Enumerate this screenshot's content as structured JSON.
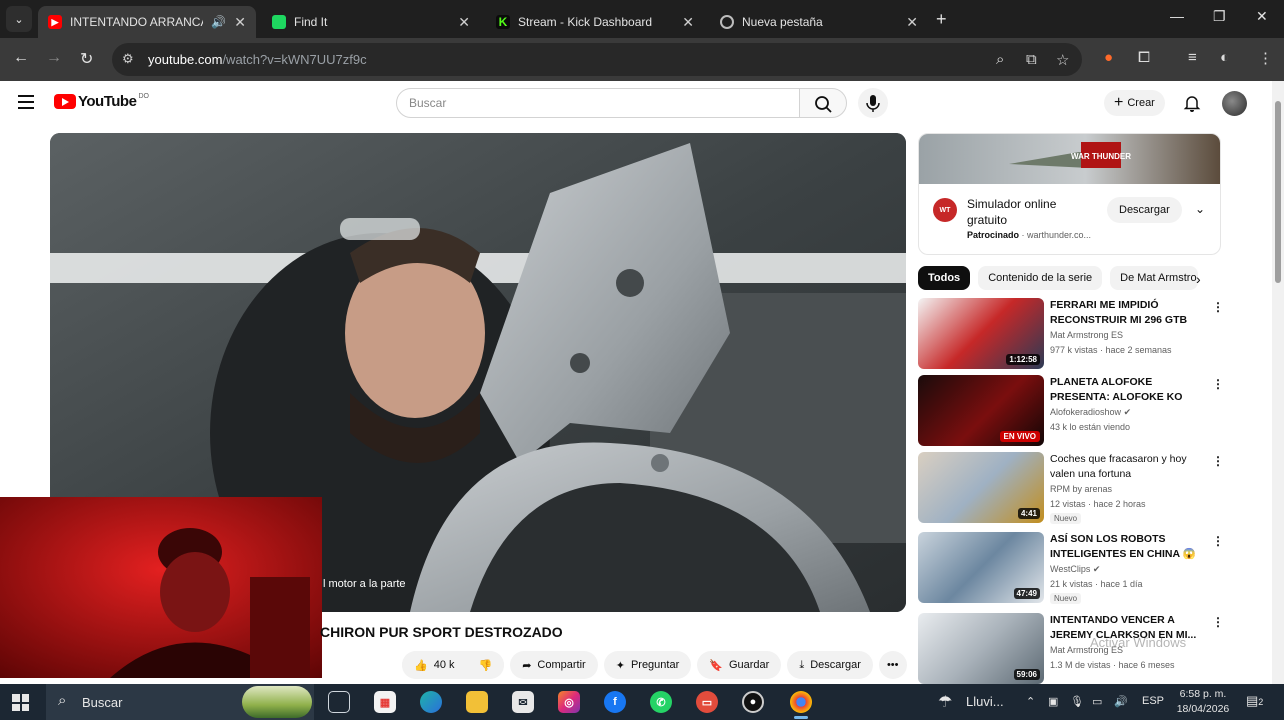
{
  "browser": {
    "tabs": [
      {
        "title": "INTENTANDO ARRANCAR EL",
        "active": true,
        "favicon": "youtube-icon"
      },
      {
        "title": "Find It",
        "active": false,
        "favicon": "find-it-icon"
      },
      {
        "title": "Stream - Kick Dashboard",
        "active": false,
        "favicon": "kick-icon"
      },
      {
        "title": "Nueva pestaña",
        "active": false,
        "favicon": "chrome-icon"
      }
    ],
    "url_host": "youtube.com",
    "url_path": "/watch?v=kWN7UU7zf9c"
  },
  "youtube": {
    "logo_text": "YouTube",
    "country_code": "DO",
    "search_placeholder": "Buscar",
    "create_label": "Crear",
    "video": {
      "subtitle": "l motor a la parte",
      "title": "CHIRON PUR SPORT DESTROZADO",
      "likes": "40 k",
      "actions": [
        "Compartir",
        "Preguntar",
        "Guardar",
        "Descargar"
      ]
    },
    "ad": {
      "title": "Simulador online gratuito",
      "sponsored": "Patrocinado",
      "domain": "warthunder.co...",
      "button": "Descargar",
      "banner_text": "WAR THUNDER"
    },
    "chips": [
      "Todos",
      "Contenido de la serie",
      "De Mat Armstro"
    ],
    "recommendations": [
      {
        "title": "FERRARI ME IMPIDIÓ RECONSTRUIR MI 296 GTB ...",
        "channel": "Mat Armstrong ES",
        "stats": "977 k vistas · hace 2 semanas",
        "duration": "1:12:58",
        "badge": ""
      },
      {
        "title": "PLANETA ALOFOKE PRESENTA: ALOFOKE KO (ESTE DOMINGO...",
        "channel": "Alofokeradioshow",
        "stats": "43 k lo están viendo",
        "duration": "EN VIVO",
        "badge": ""
      },
      {
        "title": "Coches que fracasaron y hoy valen una fortuna",
        "channel": "RPM by arenas",
        "stats": "12 vistas · hace 2 horas",
        "duration": "4:41",
        "badge": "Nuevo"
      },
      {
        "title": "ASÍ SON LOS ROBOTS INTELIGENTES EN CHINA 😱 |...",
        "channel": "WestClips",
        "stats": "21 k vistas · hace 1 día",
        "duration": "47:49",
        "badge": "Nuevo"
      },
      {
        "title": "INTENTANDO VENCER A JEREMY CLARKSON EN MI...",
        "channel": "Mat Armstrong ES",
        "stats": "1.3 M de vistas · hace 6 meses",
        "duration": "59:06",
        "badge": ""
      }
    ],
    "watermark": "Activar Windows"
  },
  "taskbar": {
    "search_label": "Buscar",
    "weather": "Lluvi...",
    "lang": "ESP",
    "time": "6:58 p. m.",
    "date": "18/04/2026",
    "notifications": "2"
  },
  "colors": {
    "accent": "#ff0000",
    "kick": "#53fc18",
    "findit": "#1ed760",
    "taskbar": "#1c2733"
  }
}
